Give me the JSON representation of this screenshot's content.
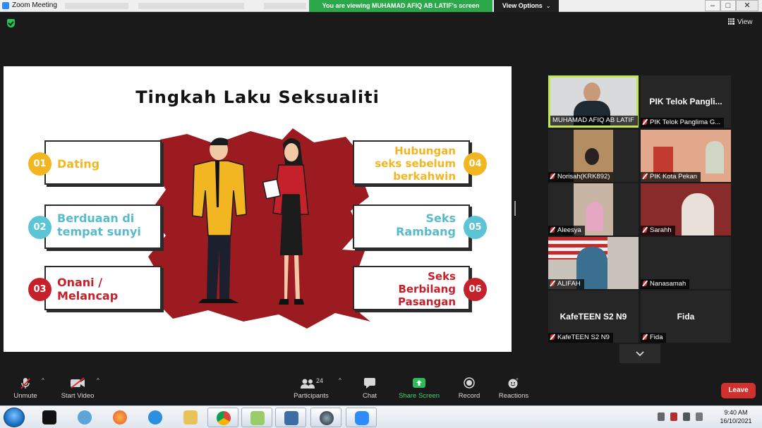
{
  "window": {
    "title": "Zoom Meeting",
    "viewing_banner": "You are viewing MUHAMAD AFIQ AB LATIF's screen",
    "view_options_label": "View Options",
    "view_label": "View"
  },
  "slide": {
    "title": "Tingkah Laku Seksualiti",
    "items": [
      {
        "number": "01",
        "line1": "Dating",
        "line2": "",
        "line3": "",
        "color": "#f3b623"
      },
      {
        "number": "02",
        "line1": "Berduaan di",
        "line2": "tempat sunyi",
        "line3": "",
        "color": "#56bccd"
      },
      {
        "number": "03",
        "line1": "Onani /",
        "line2": "Melancap",
        "line3": "",
        "color": "#c4212b"
      },
      {
        "number": "04",
        "line1": "Hubungan",
        "line2": "seks sebelum",
        "line3": "berkahwin",
        "color": "#f3b623"
      },
      {
        "number": "05",
        "line1": "Seks",
        "line2": "Rambang",
        "line3": "",
        "color": "#56bccd"
      },
      {
        "number": "06",
        "line1": "Seks",
        "line2": "Berbilang",
        "line3": "Pasangan",
        "color": "#c4212b"
      }
    ]
  },
  "participants_gallery": [
    {
      "nametag": "MUHAMAD AFIQ AB LATIF",
      "muted": false,
      "video": true,
      "active_speaker": true,
      "center_name": ""
    },
    {
      "nametag": "PIK Telok Panglima G...",
      "muted": true,
      "video": false,
      "center_name": "PIK Telok Pangli..."
    },
    {
      "nametag": "Norisah(KRK892)",
      "muted": true,
      "video": true,
      "center_name": ""
    },
    {
      "nametag": "PIK Kota Pekan",
      "muted": true,
      "video": true,
      "center_name": ""
    },
    {
      "nametag": "Aleesya",
      "muted": true,
      "video": true,
      "center_name": ""
    },
    {
      "nametag": "Sarahh",
      "muted": true,
      "video": true,
      "center_name": ""
    },
    {
      "nametag": "ALIFAH",
      "muted": true,
      "video": true,
      "center_name": ""
    },
    {
      "nametag": "Nanasamah",
      "muted": true,
      "video": false,
      "center_name": ""
    },
    {
      "nametag": "KafeTEEN S2 N9",
      "muted": true,
      "video": false,
      "center_name": "KafeTEEN S2 N9"
    },
    {
      "nametag": "Fida",
      "muted": true,
      "video": false,
      "center_name": "Fida"
    }
  ],
  "toolbar": {
    "unmute": "Unmute",
    "start_video": "Start Video",
    "participants": "Participants",
    "participants_count": "24",
    "chat": "Chat",
    "share_screen": "Share Screen",
    "record": "Record",
    "reactions": "Reactions",
    "leave": "Leave"
  },
  "taskbar": {
    "time": "9:40 AM",
    "date": "16/10/2021"
  },
  "colors": {
    "accent_green": "#2ba84a",
    "active_speaker_border": "#c3e651",
    "leave_red": "#d0312d",
    "slide_burst": "#9b1b21"
  }
}
